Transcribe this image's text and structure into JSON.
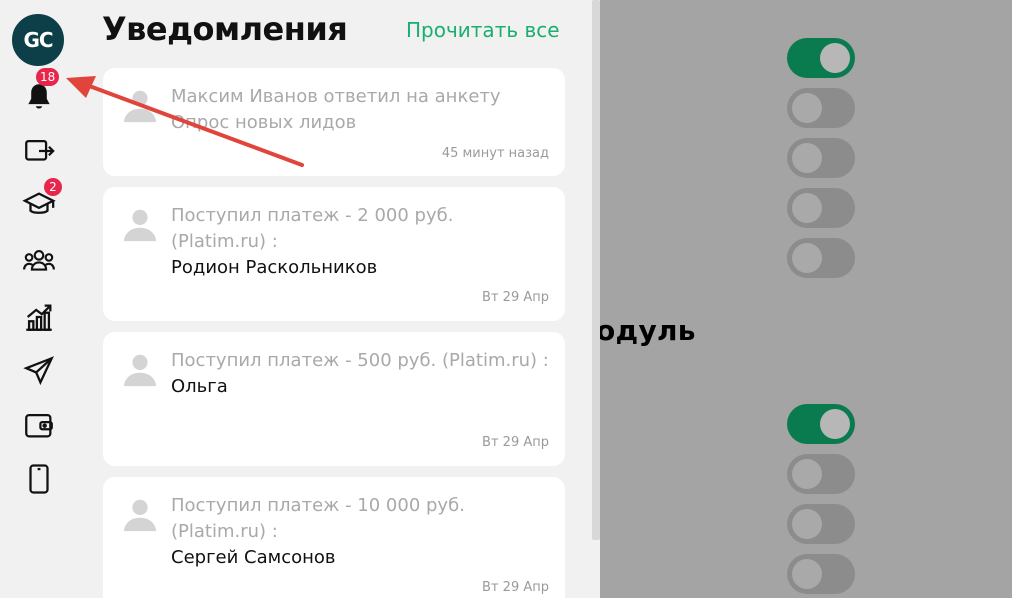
{
  "background": {
    "heading": "одуль",
    "toggles": [
      true,
      false,
      false,
      false,
      false,
      true,
      false,
      false,
      false
    ]
  },
  "sidebar": {
    "logo_text": "GC",
    "bell_badge": "18",
    "course_badge": "2",
    "icons": [
      "bell-icon",
      "logout-icon",
      "graduation-cap-icon",
      "users-icon",
      "chart-icon",
      "send-icon",
      "wallet-icon",
      "phone-icon"
    ]
  },
  "panel": {
    "title": "Уведомления",
    "read_all": "Прочитать все",
    "notifications": [
      {
        "text": "Максим Иванов ответил на анкету Опрос новых лидов",
        "name": "",
        "time": "45 минут назад"
      },
      {
        "text": "Поступил платеж - 2 000 руб. (Platim.ru) :",
        "name": "Родион Раскольников",
        "time": "Вт 29 Апр"
      },
      {
        "text": "Поступил платеж - 500 руб. (Platim.ru) :",
        "name": "Ольга",
        "time": "Вт 29 Апр"
      },
      {
        "text": "Поступил платеж - 10 000 руб. (Platim.ru) :",
        "name": "Сергей Самсонов",
        "time": "Вт 29 Апр"
      }
    ]
  },
  "colors": {
    "accent": "#1aaf6e",
    "toggle_on": "#0a7a4f",
    "badge": "#e8254a",
    "arrow": "#e0443a"
  }
}
